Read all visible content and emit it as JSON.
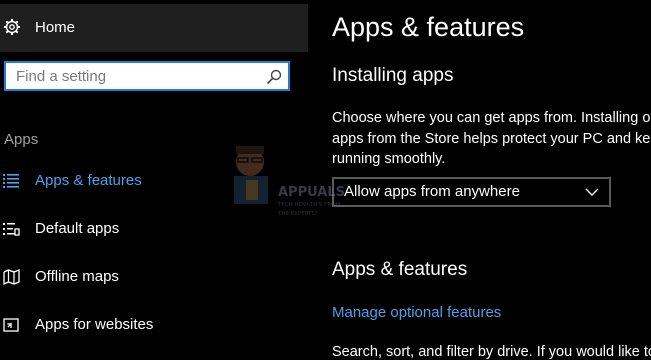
{
  "sidebar": {
    "home_label": "Home",
    "search_placeholder": "Find a setting",
    "section_label": "Apps",
    "items": [
      {
        "label": "Apps & features",
        "icon": "list-icon",
        "active": true
      },
      {
        "label": "Default apps",
        "icon": "default-apps-icon",
        "active": false
      },
      {
        "label": "Offline maps",
        "icon": "map-icon",
        "active": false
      },
      {
        "label": "Apps for websites",
        "icon": "apps-websites-icon",
        "active": false
      }
    ]
  },
  "main": {
    "title": "Apps & features",
    "installing_heading": "Installing apps",
    "installing_desc_lines": [
      "Choose where you can get apps from. Installing only",
      "apps from the Store helps protect your PC and keep it",
      "running smoothly."
    ],
    "dropdown_value": "Allow apps from anywhere",
    "apps_features_heading": "Apps & features",
    "manage_link": "Manage optional features",
    "bottom_desc": "Search, sort, and filter by drive. If you would like to"
  },
  "watermark": {
    "text_1": "APPUALS",
    "text_2": "TECH HOW-TO'S FROM",
    "text_3": "THE EXPERTS!"
  },
  "colors": {
    "accent": "#4aa0ec",
    "search_border": "#1e7fd6",
    "home_bg": "#1f1f1f"
  }
}
